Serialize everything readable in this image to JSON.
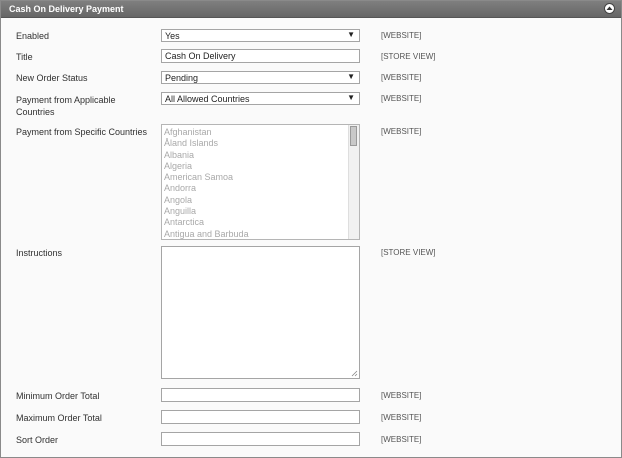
{
  "section": {
    "title": "Cash On Delivery Payment",
    "collapse_icon": "chevron-up-icon"
  },
  "fields": {
    "enabled": {
      "label": "Enabled",
      "value": "Yes",
      "scope": "[WEBSITE]"
    },
    "title": {
      "label": "Title",
      "value": "Cash On Delivery",
      "scope": "[STORE VIEW]"
    },
    "new_order_status": {
      "label": "New Order Status",
      "value": "Pending",
      "scope": "[WEBSITE]"
    },
    "applicable_countries": {
      "label_line1": "Payment from Applicable",
      "label_line2": "Countries",
      "value": "All Allowed Countries",
      "scope": "[WEBSITE]"
    },
    "specific_countries": {
      "label": "Payment from Specific Countries",
      "scope": "[WEBSITE]",
      "options": [
        "Afghanistan",
        "Åland Islands",
        "Albania",
        "Algeria",
        "American Samoa",
        "Andorra",
        "Angola",
        "Anguilla",
        "Antarctica",
        "Antigua and Barbuda"
      ]
    },
    "instructions": {
      "label": "Instructions",
      "value": "",
      "scope": "[STORE VIEW]"
    },
    "min_order_total": {
      "label": "Minimum Order Total",
      "value": "",
      "scope": "[WEBSITE]"
    },
    "max_order_total": {
      "label": "Maximum Order Total",
      "value": "",
      "scope": "[WEBSITE]"
    },
    "sort_order": {
      "label": "Sort Order",
      "value": "",
      "scope": "[WEBSITE]"
    }
  },
  "colors": {
    "header_bg": "#6e6e6e",
    "panel_bg": "#fafafa",
    "disabled_text": "#a9a9a9"
  }
}
